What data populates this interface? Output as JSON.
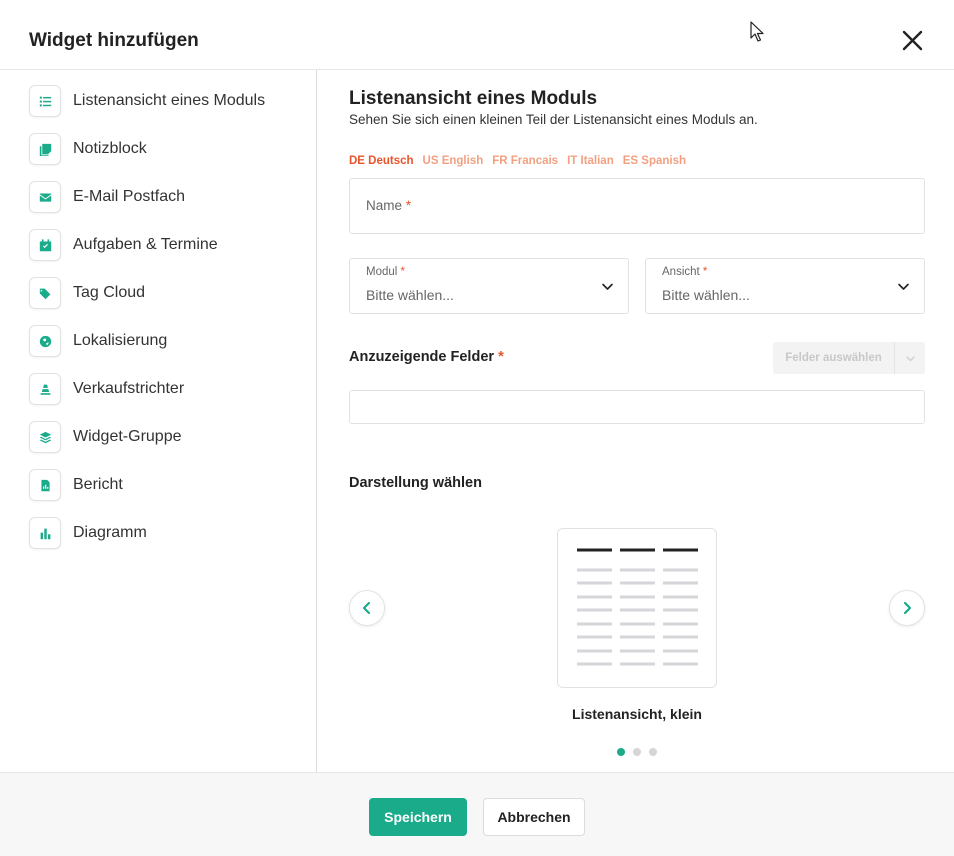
{
  "dialog": {
    "title": "Widget hinzufügen"
  },
  "sidebar": {
    "items": [
      {
        "label": "Listenansicht eines Moduls",
        "icon": "list-icon"
      },
      {
        "label": "Notizblock",
        "icon": "notes-icon"
      },
      {
        "label": "E-Mail Postfach",
        "icon": "envelope-icon"
      },
      {
        "label": "Aufgaben & Termine",
        "icon": "calendar-check-icon"
      },
      {
        "label": "Tag Cloud",
        "icon": "tags-icon"
      },
      {
        "label": "Lokalisierung",
        "icon": "globe-icon"
      },
      {
        "label": "Verkaufstrichter",
        "icon": "funnel-icon"
      },
      {
        "label": "Widget-Gruppe",
        "icon": "layers-icon"
      },
      {
        "label": "Bericht",
        "icon": "file-chart-icon"
      },
      {
        "label": "Diagramm",
        "icon": "bar-chart-icon"
      }
    ]
  },
  "main": {
    "title": "Listenansicht eines Moduls",
    "subtitle": "Sehen Sie sich einen kleinen Teil der Listenansicht eines Moduls an.",
    "languages": [
      {
        "label": "DE Deutsch",
        "active": true
      },
      {
        "label": "US English",
        "active": false
      },
      {
        "label": "FR Francais",
        "active": false
      },
      {
        "label": "IT Italian",
        "active": false
      },
      {
        "label": "ES Spanish",
        "active": false
      }
    ],
    "name_field": {
      "label": "Name",
      "required_mark": "*",
      "value": ""
    },
    "module_select": {
      "label": "Modul",
      "required_mark": "*",
      "value": "Bitte wählen..."
    },
    "view_select": {
      "label": "Ansicht",
      "required_mark": "*",
      "value": "Bitte wählen..."
    },
    "fields_section": {
      "label": "Anzuzeigende Felder",
      "required_mark": "*",
      "button_label": "Felder auswählen",
      "value": ""
    },
    "display_section": {
      "title": "Darstellung wählen",
      "selected_label": "Listenansicht, klein",
      "slide_count": 3,
      "active_slide": 0
    }
  },
  "footer": {
    "save_label": "Speichern",
    "cancel_label": "Abbrechen"
  },
  "colors": {
    "accent": "#1aab8a",
    "lang_active": "#e8542b",
    "lang_inactive": "#f2a081",
    "required": "#e8542b"
  }
}
